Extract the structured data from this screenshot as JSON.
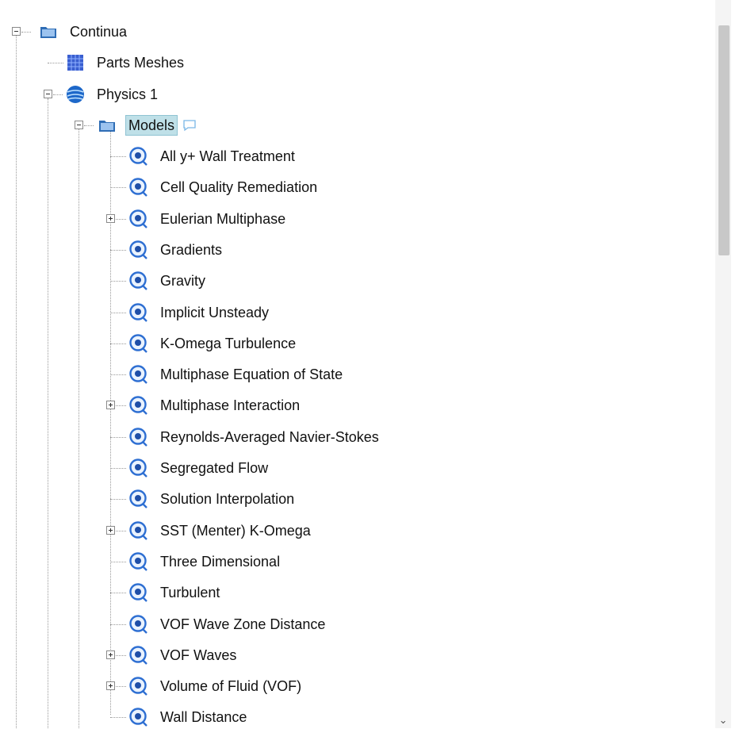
{
  "tree": {
    "root": {
      "label": "Continua",
      "icon": "folder-icon",
      "expanded": true
    },
    "parts_meshes": {
      "label": "Parts Meshes",
      "icon": "mesh-grid-icon"
    },
    "physics": {
      "label": "Physics 1",
      "icon": "physics-sphere-icon",
      "expanded": true
    },
    "models": {
      "label": "Models",
      "icon": "folder-icon",
      "expanded": true,
      "selected": true,
      "comment_icon": "comment-bubble-icon"
    },
    "model_items": [
      {
        "label": "All y+ Wall Treatment",
        "expandable": false
      },
      {
        "label": "Cell Quality Remediation",
        "expandable": false
      },
      {
        "label": "Eulerian Multiphase",
        "expandable": true
      },
      {
        "label": "Gradients",
        "expandable": false
      },
      {
        "label": "Gravity",
        "expandable": false
      },
      {
        "label": "Implicit Unsteady",
        "expandable": false
      },
      {
        "label": "K-Omega Turbulence",
        "expandable": false
      },
      {
        "label": "Multiphase Equation of State",
        "expandable": false
      },
      {
        "label": "Multiphase Interaction",
        "expandable": true
      },
      {
        "label": "Reynolds-Averaged Navier-Stokes",
        "expandable": false
      },
      {
        "label": "Segregated Flow",
        "expandable": false
      },
      {
        "label": "Solution Interpolation",
        "expandable": false
      },
      {
        "label": "SST (Menter) K-Omega",
        "expandable": true
      },
      {
        "label": "Three Dimensional",
        "expandable": false
      },
      {
        "label": "Turbulent",
        "expandable": false
      },
      {
        "label": "VOF Wave Zone Distance",
        "expandable": false
      },
      {
        "label": "VOF Waves",
        "expandable": true
      },
      {
        "label": "Volume of Fluid (VOF)",
        "expandable": true
      },
      {
        "label": "Wall Distance",
        "expandable": false
      }
    ],
    "model_icon": "model-node-icon"
  },
  "colors": {
    "folder": "#2f6db5",
    "physics": "#1e68c9",
    "mesh": "#3a5fd0",
    "model_ring": "#2e6fd2",
    "selection_bg": "#bfe0e8"
  },
  "scrollbar": {
    "down_arrow": "⌄"
  }
}
